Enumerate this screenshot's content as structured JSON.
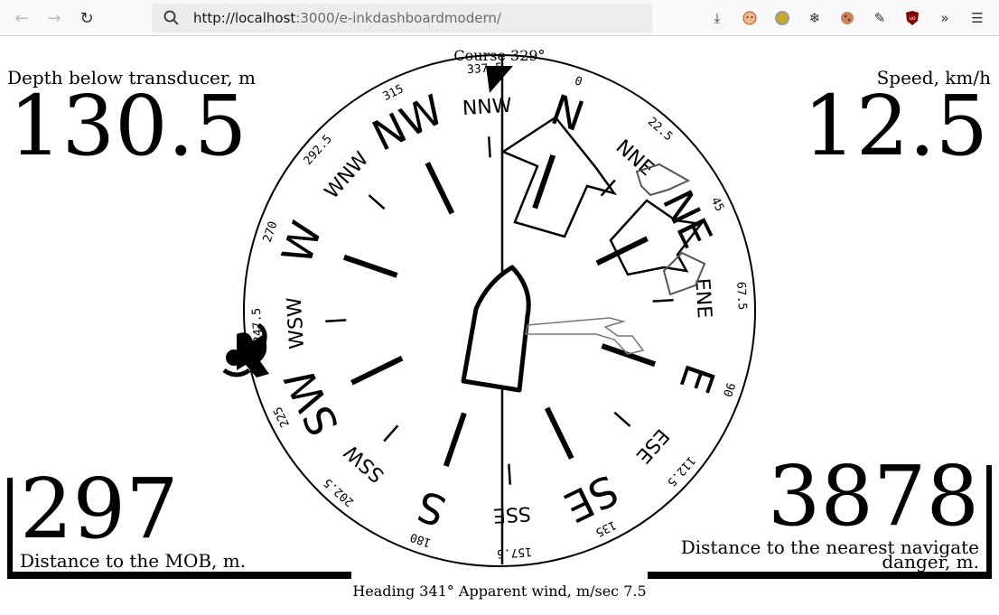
{
  "browser": {
    "url_host": "http://localhost",
    "url_rest": ":3000/e-inkdashboardmodern/"
  },
  "depth": {
    "label": "Depth below transducer, m",
    "value": "130.5"
  },
  "speed": {
    "label": "Speed, km/h",
    "value": "12.5"
  },
  "mob": {
    "value": "297",
    "label": "Distance to the MOB, m."
  },
  "danger": {
    "value": "3878",
    "label_line1": "Distance to the nearest navigate",
    "label_line2": "danger, m."
  },
  "compass": {
    "course_label": "Course 329°",
    "heading_label": "Heading 341° Apparent wind, m/sec 7.5",
    "heading_deg": 341,
    "course_deg": 329,
    "points": [
      {
        "name": "N",
        "deg": 0,
        "major": true
      },
      {
        "name": "NNE",
        "deg": 22.5,
        "major": false
      },
      {
        "name": "NE",
        "deg": 45,
        "major": true
      },
      {
        "name": "ENE",
        "deg": 67.5,
        "major": false
      },
      {
        "name": "E",
        "deg": 90,
        "major": true
      },
      {
        "name": "ESE",
        "deg": 112.5,
        "major": false
      },
      {
        "name": "SE",
        "deg": 135,
        "major": true
      },
      {
        "name": "SSE",
        "deg": 157.5,
        "major": false
      },
      {
        "name": "S",
        "deg": 180,
        "major": true
      },
      {
        "name": "SSW",
        "deg": 202.5,
        "major": false
      },
      {
        "name": "SW",
        "deg": 225,
        "major": true
      },
      {
        "name": "WSW",
        "deg": 247.5,
        "major": false
      },
      {
        "name": "W",
        "deg": 270,
        "major": true
      },
      {
        "name": "WNW",
        "deg": 292.5,
        "major": false
      },
      {
        "name": "NW",
        "deg": 315,
        "major": true
      },
      {
        "name": "NNW",
        "deg": 337.5,
        "major": false
      }
    ],
    "degree_marks": [
      "0",
      "22.5",
      "45",
      "67.5",
      "90",
      "112.5",
      "135",
      "157.5",
      "180",
      "202.5",
      "225",
      "247.5",
      "270",
      "292.5",
      "315",
      "337.5"
    ]
  }
}
